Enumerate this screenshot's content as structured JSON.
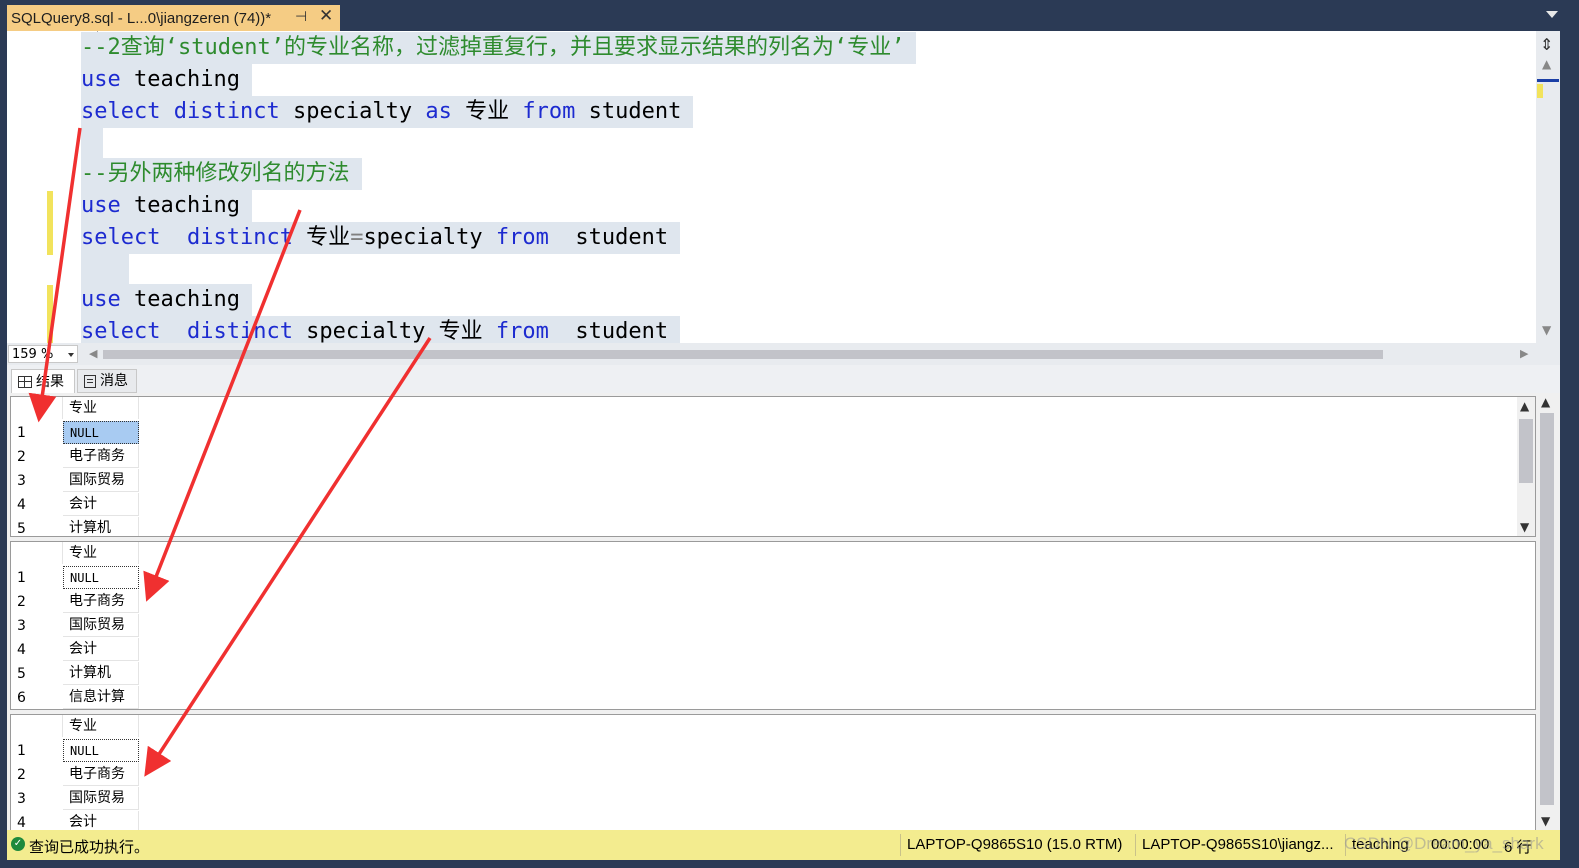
{
  "tab": {
    "title": "SQLQuery8.sql - L...0\\jiangzeren (74))*"
  },
  "editor": {
    "lines": [
      {
        "text": "--2查询‘student’的专业名称，过滤掉重复行，并且要求显示结果的列名为‘专业’"
      },
      {
        "kw1": "use",
        "rest": " teaching"
      },
      {
        "kw1": "select",
        "kw2": " distinct",
        "mid": " specialty ",
        "kw3": "as",
        "mid2": " 专业 ",
        "kw4": "from",
        "rest": " student"
      },
      {
        "text": ""
      },
      {
        "text": "--另外两种修改列名的方法"
      },
      {
        "kw1": "use",
        "rest": " teaching"
      },
      {
        "kw1": "select",
        "kw2": "  distinct",
        "mid": " 专业",
        "op": "=",
        "mid2": "specialty ",
        "kw4": "from",
        "rest": "  student"
      },
      {
        "text": ""
      },
      {
        "kw1": "use",
        "rest": " teaching"
      },
      {
        "kw1": "select",
        "kw2": "  distinct",
        "mid": " specialty 专业 ",
        "kw4": "from",
        "rest": "  student"
      }
    ]
  },
  "zoom": {
    "value": "159 %"
  },
  "result_tabs": {
    "results": "结果",
    "messages": "消息"
  },
  "results": [
    {
      "header": "专业",
      "rows": [
        [
          "1",
          "NULL"
        ],
        [
          "2",
          "电子商务"
        ],
        [
          "3",
          "国际贸易"
        ],
        [
          "4",
          "会计"
        ],
        [
          "5",
          "计算机"
        ]
      ]
    },
    {
      "header": "专业",
      "rows": [
        [
          "1",
          "NULL"
        ],
        [
          "2",
          "电子商务"
        ],
        [
          "3",
          "国际贸易"
        ],
        [
          "4",
          "会计"
        ],
        [
          "5",
          "计算机"
        ],
        [
          "6",
          "信息计算"
        ]
      ]
    },
    {
      "header": "专业",
      "rows": [
        [
          "1",
          "NULL"
        ],
        [
          "2",
          "电子商务"
        ],
        [
          "3",
          "国际贸易"
        ],
        [
          "4",
          "会计"
        ]
      ]
    }
  ],
  "status": {
    "message": "查询已成功执行。",
    "server": "LAPTOP-Q9865S10 (15.0 RTM)",
    "user": "LAPTOP-Q9865S10\\jiangz...",
    "database": "teaching",
    "time": "00:00:00",
    "rows": "6 行",
    "watermark": "CSDN @Dream_ya_shark"
  },
  "colors": {
    "keyword": "#1d2bd0",
    "comment": "#2e8b2e",
    "status_bar": "#f3ec8f",
    "tab_active": "#f5cc84",
    "arrow": "#f03030"
  }
}
